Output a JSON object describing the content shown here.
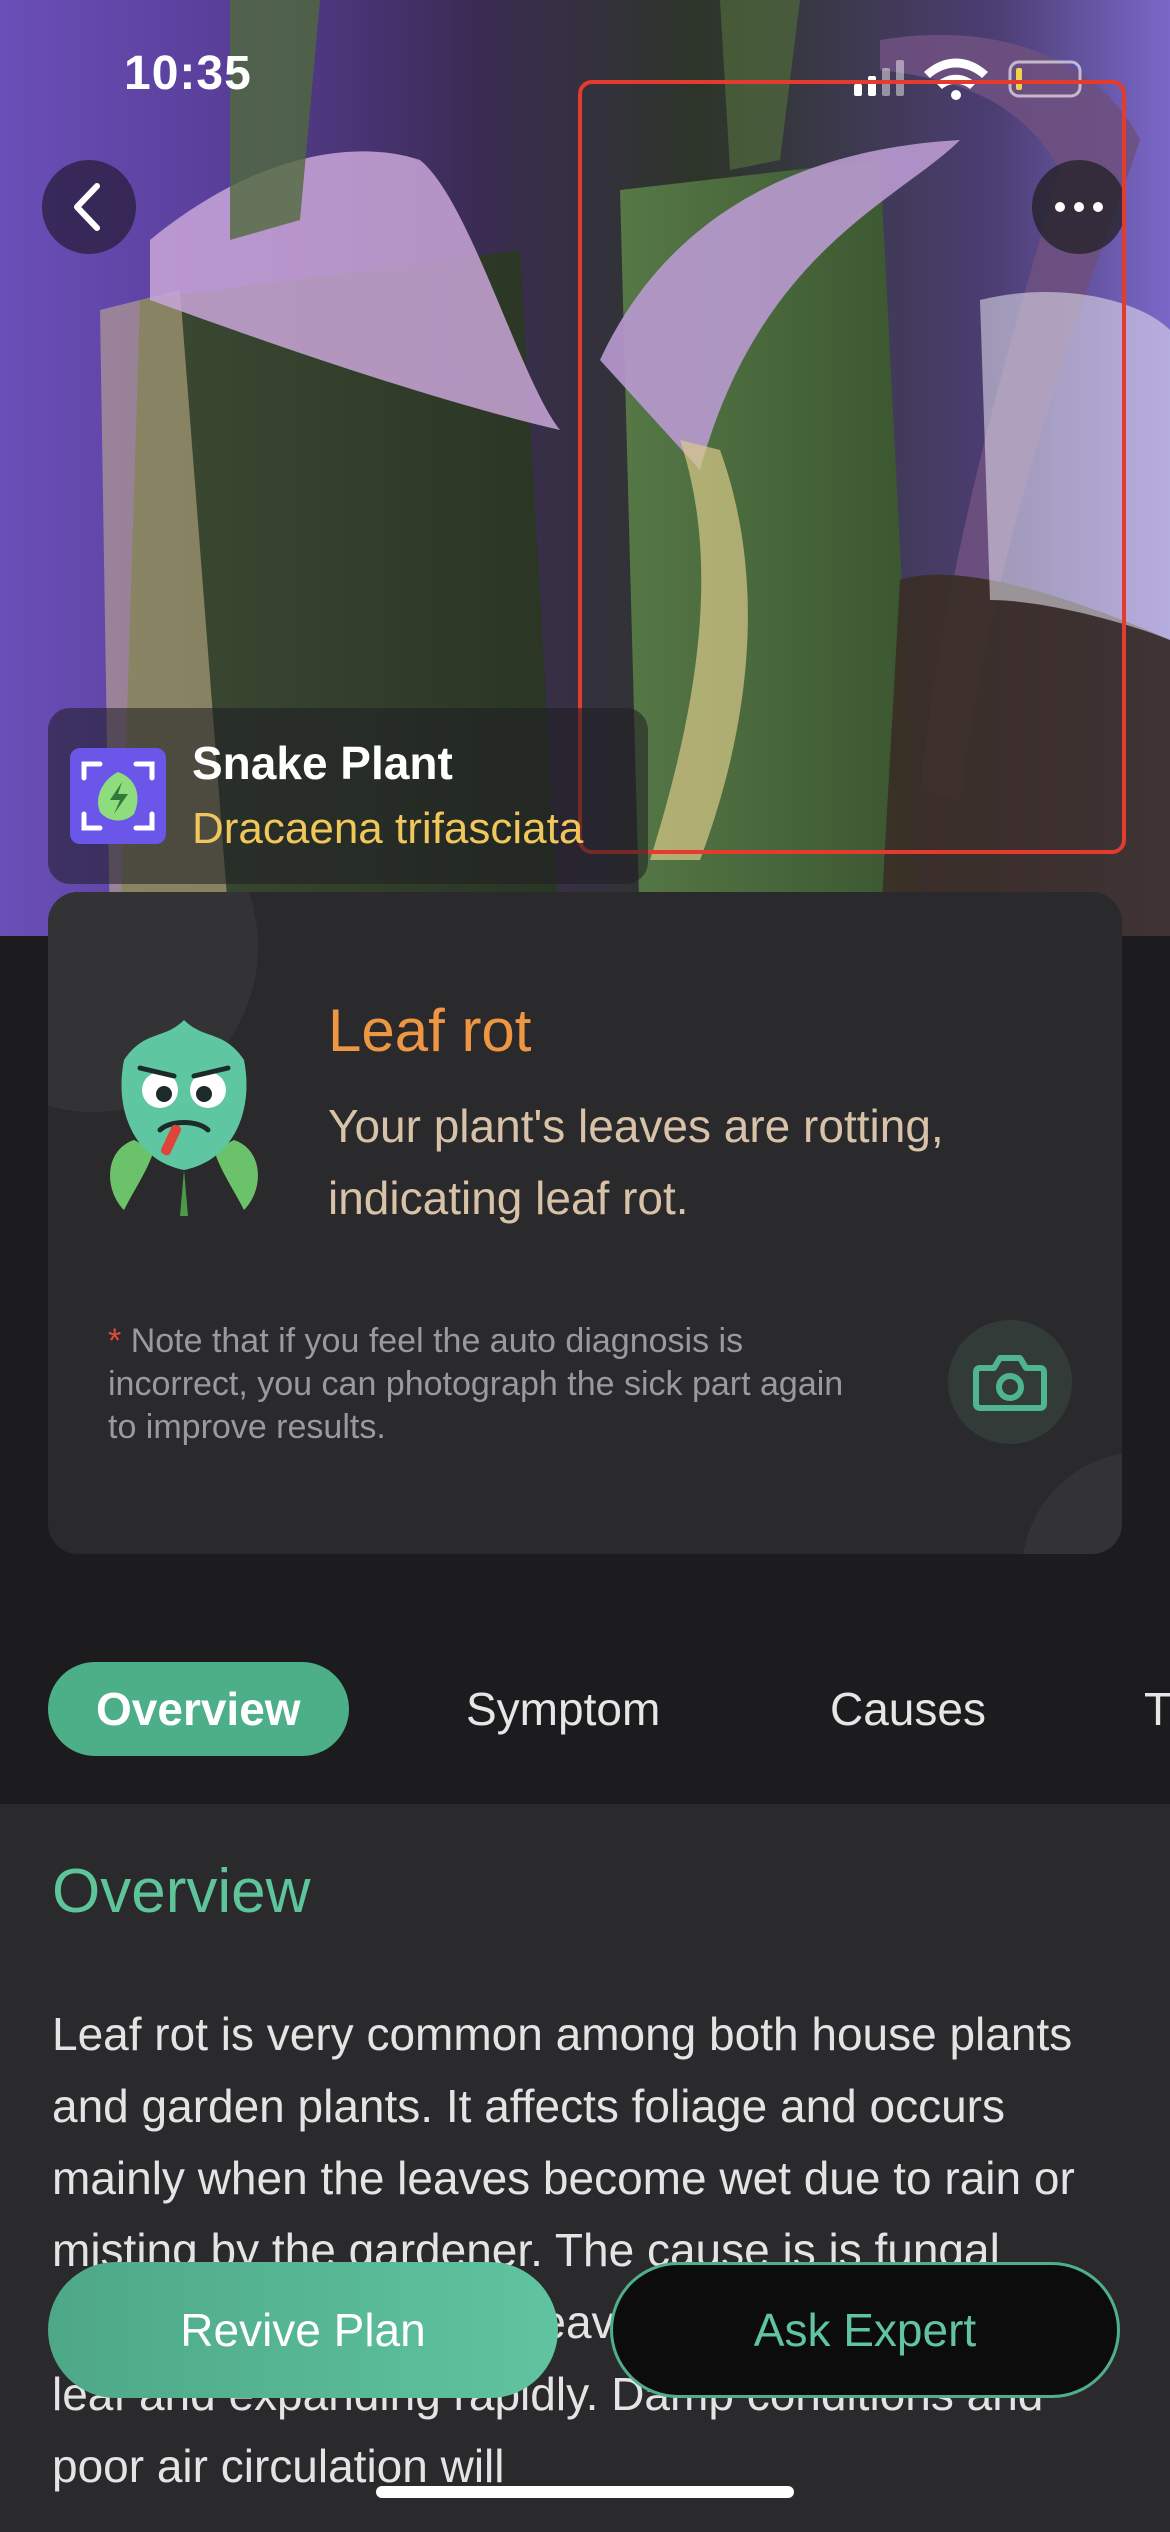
{
  "status_bar": {
    "time": "10:35"
  },
  "header": {
    "back_icon": "chevron-left-icon",
    "more_icon": "ellipsis-icon",
    "plant": {
      "name": "Snake Plant",
      "scientific_name": "Dracaena trifasciata"
    }
  },
  "diagnosis": {
    "title": "Leaf rot",
    "description": "Your plant's leaves are rotting, indicating leaf rot.",
    "note_star": "*",
    "note": "Note that if you feel the auto diagnosis is incorrect, you can photograph the sick part again to improve results.",
    "camera_icon": "camera-icon"
  },
  "tabs": [
    {
      "label": "Overview",
      "active": true
    },
    {
      "label": "Symptom",
      "active": false
    },
    {
      "label": "Causes",
      "active": false
    },
    {
      "label": "T",
      "active": false
    }
  ],
  "overview": {
    "title": "Overview",
    "text": "Leaf rot is very common among both house plants and garden plants. It affects foliage and occurs mainly when the leaves become wet due to rain or misting by the gardener. The cause is is fungal spores adhering to wet leaves then penetrating the leaf and expanding rapidly. Damp conditions and poor air circulation will"
  },
  "actions": {
    "revive_label": "Revive Plan",
    "ask_label": "Ask Expert"
  },
  "colors": {
    "accent": "#4caf87",
    "warning": "#ef9642",
    "detect_box": "#e33b2e",
    "scientific_name": "#f0c75a"
  }
}
